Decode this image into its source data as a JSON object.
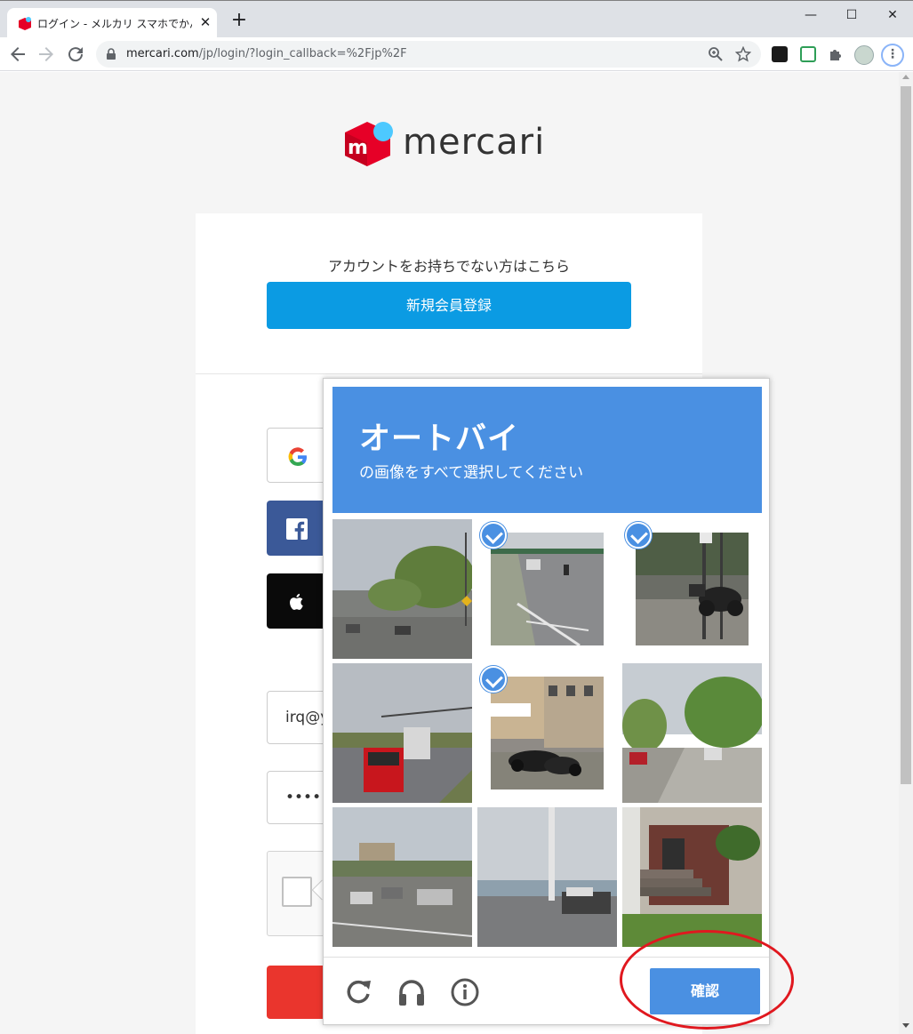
{
  "browser": {
    "tab_title": "ログイン - メルカリ スマホでかんたん フ",
    "tab_close": "✕",
    "new_tab": "+",
    "url_host": "mercari.com",
    "url_path": "/jp/login/?login_callback=%2Fjp%2F",
    "window_minimize": "—",
    "window_maximize": "☐",
    "window_close": "✕"
  },
  "page": {
    "logo_text": "mercari",
    "signup_prompt": "アカウントをお持ちでない方はこちら",
    "signup_button": "新規会員登録",
    "email_value": "irq@y",
    "password_value": "••••••••"
  },
  "captcha": {
    "title": "オートバイ",
    "subtitle": "の画像をすべて選択してください",
    "tiles_selected": [
      false,
      true,
      true,
      false,
      true,
      false,
      false,
      false,
      false
    ],
    "verify_button": "確認"
  },
  "colors": {
    "captcha_blue": "#4a90e2",
    "signup_blue": "#0b9be3",
    "login_red": "#ea352d",
    "mercari_red": "#e60027",
    "annotation_red": "#e0181f"
  }
}
